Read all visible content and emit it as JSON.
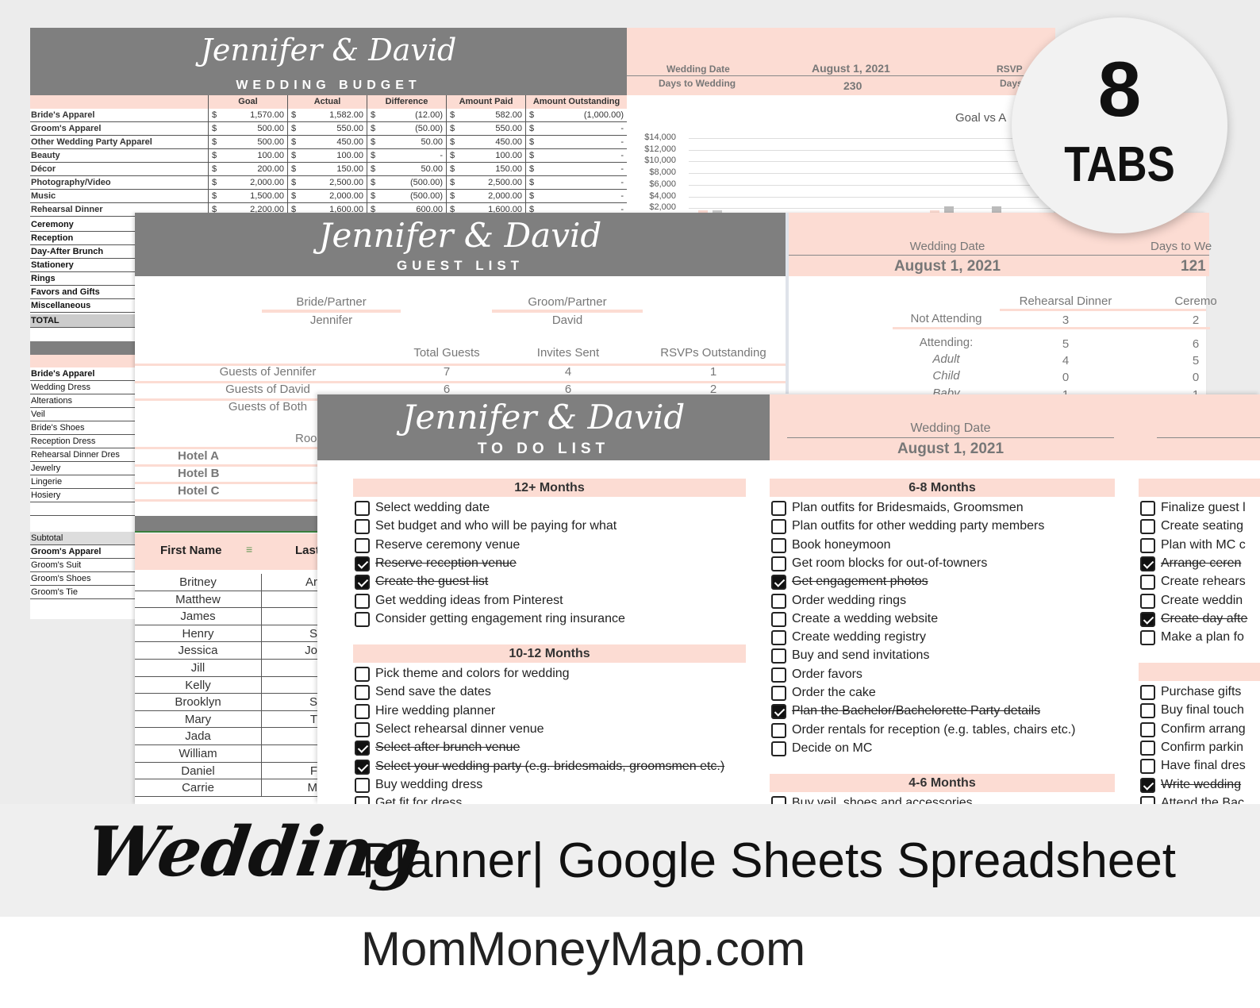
{
  "budget": {
    "script_title": "Jennifer & David",
    "title": "WEDDING BUDGET",
    "columns": [
      "",
      "Goal",
      "Actual",
      "Difference",
      "Amount Paid",
      "Amount Outstanding"
    ],
    "rows": [
      {
        "label": "Bride's Apparel",
        "goal": "1,570.00",
        "actual": "1,582.00",
        "difference": "(12.00)",
        "paid": "582.00",
        "outstanding": "(1,000.00)"
      },
      {
        "label": "Groom's Apparel",
        "goal": "500.00",
        "actual": "550.00",
        "difference": "(50.00)",
        "paid": "550.00",
        "outstanding": "-"
      },
      {
        "label": "Other Wedding Party Apparel",
        "goal": "500.00",
        "actual": "450.00",
        "difference": "50.00",
        "paid": "450.00",
        "outstanding": "-"
      },
      {
        "label": "Beauty",
        "goal": "100.00",
        "actual": "100.00",
        "difference": "-",
        "paid": "100.00",
        "outstanding": "-"
      },
      {
        "label": "Décor",
        "goal": "200.00",
        "actual": "150.00",
        "difference": "50.00",
        "paid": "150.00",
        "outstanding": "-"
      },
      {
        "label": "Photography/Video",
        "goal": "2,000.00",
        "actual": "2,500.00",
        "difference": "(500.00)",
        "paid": "2,500.00",
        "outstanding": "-"
      },
      {
        "label": "Music",
        "goal": "1,500.00",
        "actual": "2,000.00",
        "difference": "(500.00)",
        "paid": "2,000.00",
        "outstanding": "-"
      },
      {
        "label": "Rehearsal Dinner",
        "goal": "2,200.00",
        "actual": "1,600.00",
        "difference": "600.00",
        "paid": "1,600.00",
        "outstanding": "-"
      }
    ],
    "currency": "$",
    "more_categories": [
      "Ceremony",
      "Reception",
      "Day-After Brunch",
      "Stationery",
      "Rings",
      "Favors and Gifts",
      "Miscellaneous"
    ],
    "total_label": "TOTAL",
    "brides_items": [
      "Bride's Apparel",
      "Wedding Dress",
      "Alterations",
      "Veil",
      "Bride's Shoes",
      "Reception Dress",
      "Rehearsal Dinner Dres",
      "Jewelry",
      "Lingerie",
      "Hosiery"
    ],
    "subtotal_label": "Subtotal",
    "grooms_items": [
      "Groom's Apparel",
      "Groom's Suit",
      "Groom's Shoes",
      "Groom's Tie"
    ],
    "summary": {
      "wedding_date_label": "Wedding Date",
      "wedding_date": "August 1, 2021",
      "days_label": "Days to Wedding",
      "days": "230",
      "rsvp_label": "RSVP",
      "days2_label": "Days"
    }
  },
  "chart_data": {
    "type": "bar",
    "title": "Goal vs A",
    "yticks": [
      "$14,000",
      "$12,000",
      "$10,000",
      "$8,000",
      "$6,000",
      "$4,000",
      "$2,000"
    ],
    "ylim": [
      2000,
      14000
    ],
    "grid": true
  },
  "guest_list": {
    "script_title": "Jennifer & David",
    "title": "GUEST LIST",
    "bride_label": "Bride/Partner",
    "bride": "Jennifer",
    "groom_label": "Groom/Partner",
    "groom": "David",
    "columns": [
      "Total Guests",
      "Invites Sent",
      "RSVPs Outstanding"
    ],
    "rows": [
      {
        "label": "Guests of Jennifer",
        "values": [
          "7",
          "4",
          "1"
        ]
      },
      {
        "label": "Guests of David",
        "values": [
          "6",
          "6",
          "2"
        ]
      },
      {
        "label": "Guests of Both",
        "values": []
      }
    ],
    "rooms_label": "Roo",
    "hotels": [
      "Hotel A",
      "Hotel B",
      "Hotel C"
    ],
    "first_name_header": "First Name",
    "last_name_header": "Last",
    "guests": [
      [
        "Britney",
        "Ar"
      ],
      [
        "Matthew",
        ""
      ],
      [
        "James",
        ""
      ],
      [
        "Henry",
        "S"
      ],
      [
        "Jessica",
        "Jo"
      ],
      [
        "Jill",
        ""
      ],
      [
        "Kelly",
        ""
      ],
      [
        "Brooklyn",
        "S"
      ],
      [
        "Mary",
        "T"
      ],
      [
        "Jada",
        ""
      ],
      [
        "William",
        ""
      ],
      [
        "Daniel",
        "F"
      ],
      [
        "Carrie",
        "M"
      ]
    ],
    "summary": {
      "wedding_date_label": "Wedding Date",
      "wedding_date": "August 1, 2021",
      "days_label": "Days to We",
      "days": "121",
      "events": [
        "Rehearsal Dinner",
        "Ceremo"
      ],
      "rows": [
        {
          "label": "Not Attending",
          "values": [
            "3",
            "2"
          ]
        },
        {
          "label": "Attending:",
          "values": [
            "5",
            "6"
          ]
        },
        {
          "label": "Adult",
          "values": [
            "4",
            "5"
          ]
        },
        {
          "label": "Child",
          "values": [
            "0",
            "0"
          ]
        },
        {
          "label": "Baby",
          "values": [
            "1",
            "1"
          ]
        }
      ]
    }
  },
  "todo": {
    "script_title": "Jennifer & David",
    "title": "TO DO LIST",
    "wedding_date_label": "Wedding Date",
    "wedding_date": "August 1, 2021",
    "sections": [
      {
        "title": "12+ Months",
        "items": [
          [
            "Select wedding date",
            false
          ],
          [
            "Set budget and who will be paying for what",
            false
          ],
          [
            "Reserve ceremony venue",
            false
          ],
          [
            "Reserve reception venue",
            true
          ],
          [
            "Create the guest list",
            true
          ],
          [
            "Get wedding ideas from Pinterest",
            false
          ],
          [
            "Consider getting engagement ring insurance",
            false
          ]
        ]
      },
      {
        "title": "10-12 Months",
        "items": [
          [
            "Pick theme and colors for wedding",
            false
          ],
          [
            "Send save the dates",
            false
          ],
          [
            "Hire wedding planner",
            false
          ],
          [
            "Select rehearsal dinner venue",
            false
          ],
          [
            "Select after brunch venue",
            true
          ],
          [
            "Select your wedding party (e.g. bridesmaids, groomsmen etc.)",
            true
          ],
          [
            "Buy wedding dress",
            false
          ],
          [
            "Get fit for dress",
            false
          ]
        ]
      },
      {
        "title": "6-8 Months",
        "items": [
          [
            "Plan outfits for Bridesmaids, Groomsmen",
            false
          ],
          [
            "Plan outfits for other wedding party members",
            false
          ],
          [
            "Book honeymoon",
            false
          ],
          [
            "Get room blocks for out-of-towners",
            false
          ],
          [
            "Get engagement photos",
            true
          ],
          [
            "Order wedding rings",
            false
          ],
          [
            "Create a wedding website",
            false
          ],
          [
            "Create wedding registry",
            false
          ],
          [
            "Buy and send invitations",
            false
          ],
          [
            "Order favors",
            false
          ],
          [
            "Order the cake",
            false
          ],
          [
            "Plan the Bachelor/Bachelorette Party details",
            true
          ],
          [
            "Order rentals for reception (e.g. tables, chairs etc.)",
            false
          ],
          [
            "Decide on MC",
            false
          ]
        ]
      },
      {
        "title": "4-6 Months",
        "items": [
          [
            "Buy veil, shoes and accessories",
            false
          ]
        ]
      },
      {
        "title": "",
        "items": [
          [
            "Finalize guest l",
            false
          ],
          [
            "Create seating",
            false
          ],
          [
            "Plan with MC c",
            false
          ],
          [
            "Arrange ceren",
            true
          ],
          [
            "Create rehears",
            false
          ],
          [
            "Create weddin",
            false
          ],
          [
            "Create day afte",
            true
          ],
          [
            "Make a plan fo",
            false
          ]
        ]
      },
      {
        "title": "",
        "items": [
          [
            "Purchase gifts",
            false
          ],
          [
            "Buy final touch",
            false
          ],
          [
            "Confirm arrang",
            false
          ],
          [
            "Confirm parkin",
            false
          ],
          [
            "Have final dres",
            false
          ],
          [
            "Write wedding",
            true
          ],
          [
            "Attend the Bac",
            false
          ]
        ]
      }
    ]
  },
  "badge": {
    "number": "8",
    "label": "TABS"
  },
  "banner": {
    "script": "Wedding",
    "text": "Planner| Google Sheets Spreadsheet",
    "site": "MomMoneyMap.com"
  },
  "colors": {
    "header_gray": "#7f7f7f",
    "accent_pink": "#fcdcd3"
  }
}
